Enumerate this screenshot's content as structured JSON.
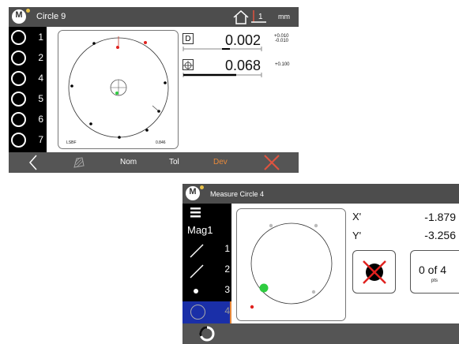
{
  "screen1": {
    "title": "Circle 9",
    "units": "mm",
    "logo_letter": "M",
    "sidebar": {
      "items": [
        {
          "num": "1"
        },
        {
          "num": "2"
        },
        {
          "num": "4"
        },
        {
          "num": "5"
        },
        {
          "num": "6"
        },
        {
          "num": "7"
        }
      ]
    },
    "plot": {
      "fit_label": "LSBF",
      "value_label": "0.846"
    },
    "readouts": {
      "d_key": "D",
      "d_value": "0.002",
      "d_tol_plus": "+0.010",
      "d_tol_minus": "-0.010",
      "pos_value": "0.068",
      "pos_tol": "+0.100"
    },
    "bottom_tabs": {
      "nom": "Nom",
      "tol": "Tol",
      "dev": "Dev"
    },
    "colors": {
      "dev_tab": "#e8893a",
      "reject": "#e0533f"
    }
  },
  "screen2": {
    "title": "Measure Circle 4",
    "logo_letter": "M",
    "sidebar": {
      "mag_label": "Mag1",
      "items": [
        {
          "num": "1"
        },
        {
          "num": "2"
        },
        {
          "num": "3"
        },
        {
          "num": "4"
        }
      ]
    },
    "coords": {
      "x_label": "X'",
      "x_value": "-1.879",
      "y_label": "Y'",
      "y_value": "-3.256"
    },
    "points": {
      "count": "0 of 4",
      "unit": "pts"
    },
    "colors": {
      "selected_item": "#1a2fa8",
      "accent": "#e8893a"
    }
  }
}
